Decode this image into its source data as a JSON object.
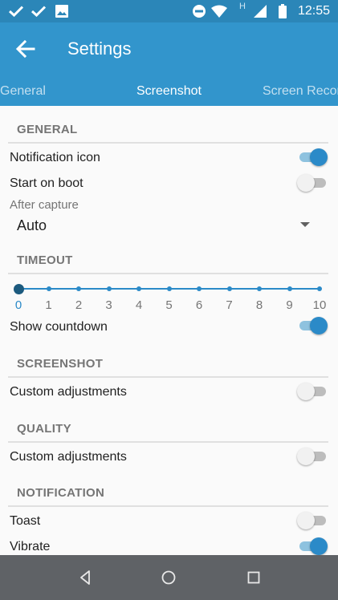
{
  "status_bar": {
    "time": "12:55",
    "left_icons": [
      "check-icon",
      "check-icon",
      "image-icon"
    ],
    "right_icons": [
      "do-not-disturb-icon",
      "wifi-icon",
      "signal-icon",
      "battery-icon"
    ],
    "network_type": "H"
  },
  "app_bar": {
    "title": "Settings",
    "back_icon": "arrow-left-icon"
  },
  "tabs": [
    {
      "label": "General",
      "active": false
    },
    {
      "label": "Screenshot",
      "active": true
    },
    {
      "label": "Screen Record",
      "active": false
    }
  ],
  "sections": {
    "general": {
      "header": "GENERAL",
      "notification_icon": {
        "label": "Notification icon",
        "on": true
      },
      "start_on_boot": {
        "label": "Start on boot",
        "on": false
      },
      "after_capture": {
        "label": "After capture",
        "value": "Auto"
      }
    },
    "timeout": {
      "header": "TIMEOUT",
      "slider": {
        "min": 0,
        "max": 10,
        "value": 0,
        "ticks": [
          "0",
          "1",
          "2",
          "3",
          "4",
          "5",
          "6",
          "7",
          "8",
          "9",
          "10"
        ]
      },
      "show_countdown": {
        "label": "Show countdown",
        "on": true
      }
    },
    "screenshot": {
      "header": "SCREENSHOT",
      "custom_adjustments": {
        "label": "Custom adjustments",
        "on": false
      }
    },
    "quality": {
      "header": "QUALITY",
      "custom_adjustments": {
        "label": "Custom adjustments",
        "on": false
      }
    },
    "notification": {
      "header": "NOTIFICATION",
      "toast": {
        "label": "Toast",
        "on": false
      },
      "vibrate": {
        "label": "Vibrate",
        "on": true
      }
    }
  },
  "nav_bar": [
    "back-triangle-icon",
    "home-circle-icon",
    "recents-square-icon"
  ],
  "colors": {
    "status_bar": "#2b86b8",
    "app_bar": "#3295cc",
    "accent": "#2b8ac8",
    "nav_bar": "#5f6266"
  }
}
